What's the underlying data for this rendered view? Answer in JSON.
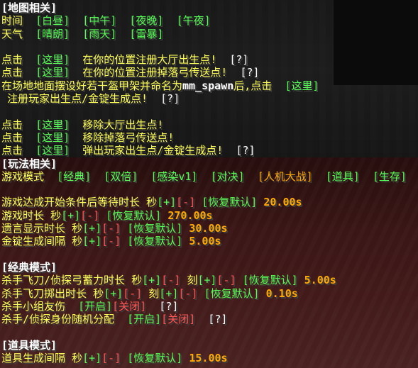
{
  "map": {
    "header": "[地图相关]",
    "time_label": "时间",
    "time_opts": [
      "[白昼]",
      "[中午]",
      "[夜晚]",
      "[午夜]"
    ],
    "weather_label": "天气",
    "weather_opts": [
      "[晴朗]",
      "[雨天]",
      "[雷暴]"
    ],
    "click": "点击",
    "here": "[这里]",
    "help": "[?]",
    "reg_lobby": "在你的位置注册大厅出生点!",
    "reg_bow": "在你的位置注册掉落弓传送点!",
    "armor_pre": "在场地地面摆设好若干盔甲架并命名为",
    "spawn_name": "mm_spawn",
    "armor_post": "后,点击",
    "armor_cont": "注册玩家出生点/金锭生成点!",
    "rm_lobby": "移除大厅出生点!",
    "rm_bow": "移除掉落弓传送点!",
    "eject": "弹出玩家出生点/金锭生成点!"
  },
  "game": {
    "header": "[玩法相关]",
    "mode_label": "游戏模式",
    "modes": [
      "[经典]",
      "[双倍]",
      "[感染v1]",
      "[对决]",
      "[人机大战]",
      "[道具]",
      "[生存]"
    ],
    "plus": "[+]",
    "minus": "[-]",
    "reset": "[恢复默认]",
    "sec": "秒",
    "tick": "刻",
    "settings": [
      {
        "label": "游戏达成开始条件后等待时长",
        "value": "20.00s"
      },
      {
        "label": "游戏时长",
        "value": "270.00s"
      },
      {
        "label": "遗言显示时长",
        "value": "30.00s"
      },
      {
        "label": "金锭生成间隔",
        "value": "5.00s"
      }
    ]
  },
  "classic": {
    "header": "[经典模式]",
    "knife_charge_label": "杀手飞刀/侦探弓蓄力时长",
    "knife_charge_value": "5.00s",
    "knife_out_label": "杀手飞刀掷出时长",
    "knife_out_value": "0.10s",
    "ff_label": "杀手小组友伤",
    "role_label": "杀手/侦探身份随机分配",
    "on": "[开启]",
    "off": "[关闭]",
    "help": "[?]"
  },
  "items": {
    "header": "[道具模式]",
    "label": "道具生成间隔",
    "value": "15.00s"
  }
}
